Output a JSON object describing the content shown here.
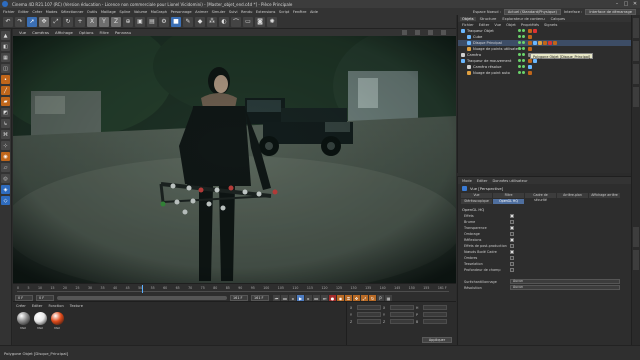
{
  "window": {
    "title": "Cinema 4D R21.107 (RC) (Version éducation - Licence non commerciale pour Lionel Vicidomini) - [Master_objet_end.c4d *] - Pièce Principale",
    "controls": [
      "–",
      "□",
      "✕"
    ]
  },
  "menubar": {
    "items": [
      "Fichier",
      "Editer",
      "Créer",
      "Modes",
      "Sélectionner",
      "Outils",
      "Maillage",
      "Spline",
      "Volume",
      "MoGraph",
      "Personnage",
      "Animer",
      "Simuler",
      "Suivi",
      "Rendu",
      "Extensions",
      "Script",
      "Fenêtre",
      "Aide"
    ],
    "node_space_label": "Espace Noeud :",
    "node_space_value": "Actuel (Standard/Physique)",
    "interface_label": "Interface :",
    "interface_value": "Interface de démarrage"
  },
  "viewport_menu": {
    "items": [
      "Vue",
      "Caméras",
      "Affichage",
      "Options",
      "Filtre",
      "Panneau"
    ]
  },
  "timeline": {
    "ticks": [
      "0",
      "5",
      "10",
      "15",
      "20",
      "25",
      "30",
      "35",
      "40",
      "45",
      "50",
      "55",
      "60",
      "65",
      "70",
      "75",
      "80",
      "85",
      "90",
      "95",
      "100",
      "105",
      "110",
      "115",
      "120",
      "125",
      "130",
      "135",
      "140",
      "145",
      "150",
      "155",
      "161 F"
    ],
    "playhead_fraction": 0.29,
    "start_field": "0 F",
    "left_field": "0 F",
    "end_field": "161 F",
    "right_field": "161 F",
    "current_frame": "0 F"
  },
  "material_manager": {
    "menu": [
      "Créer",
      "Editer",
      "Fonction",
      "Texture"
    ],
    "materials": [
      {
        "name": "Mat",
        "color": "#8a8a8a"
      },
      {
        "name": "Mat",
        "color": "#e8e8e8"
      },
      {
        "name": "Mat",
        "color": "#e04a1a"
      }
    ]
  },
  "coordinates": {
    "rows": [
      [
        "X",
        "X",
        "H"
      ],
      [
        "Y",
        "Y",
        "P"
      ],
      [
        "Z",
        "Z",
        "B"
      ]
    ],
    "apply_label": "Appliquer"
  },
  "object_manager": {
    "tabs": [
      "Objets",
      "Structure",
      "Explorateur de contenu",
      "Calques"
    ],
    "menu": [
      "Fichier",
      "Editer",
      "Vue",
      "Objet",
      "Propriétés",
      "Signets"
    ],
    "objects": [
      {
        "name": "Traqueur Objet",
        "color": "#6bb8ff"
      },
      {
        "name": "Cube",
        "color": "#6bb8ff"
      },
      {
        "name": "Disque Principal",
        "color": "#6bb8ff"
      },
      {
        "name": "Nuage de points utilisateur",
        "color": "#e0a040"
      },
      {
        "name": "Caméra",
        "color": "#cfcfcf"
      },
      {
        "name": "Traqueur de mouvement",
        "color": "#6bb8ff"
      },
      {
        "name": "Caméra résolue",
        "color": "#cfcfcf"
      },
      {
        "name": "Nuage de point auto",
        "color": "#e0a040"
      }
    ],
    "tooltip": "Polygone Objet [Disque_Principal]"
  },
  "attribute_manager": {
    "menu": [
      "Mode",
      "Editer",
      "Données utilisateur"
    ],
    "title": "Vue [Perspective]",
    "tabs": [
      "Vue",
      "Filtre",
      "Cadre de sécurité",
      "Arrière-plan",
      "Affichage arrière",
      "Stéréoscopique",
      "OpenGL HQ"
    ],
    "active_tab": "OpenGL HQ",
    "section": "OpenGL HQ",
    "options": [
      {
        "label": "Effets",
        "checked": true
      },
      {
        "label": "Brume",
        "checked": false
      },
      {
        "label": "Transparence",
        "checked": true
      },
      {
        "label": "Ombrage",
        "checked": false
      },
      {
        "label": "Réflexions",
        "checked": true
      },
      {
        "label": "Effets de post-production",
        "checked": false
      },
      {
        "label": "Nœuds Bodé Cadre",
        "checked": true
      },
      {
        "label": "Ombres",
        "checked": false
      },
      {
        "label": "Tesselation",
        "checked": false
      },
      {
        "label": "Profondeur de champ",
        "checked": false
      }
    ],
    "supersampling_label": "Suréchantillonnage",
    "supersampling_value": "Aucun",
    "resolution_label": "Résolution",
    "resolution_value": "Aucun"
  },
  "status": {
    "text": "Polygone Objet [Disque_Principal]"
  },
  "colors": {
    "accent_blue": "#3b6fb4",
    "accent_orange": "#c0661a",
    "panel": "#2d2d2d"
  }
}
